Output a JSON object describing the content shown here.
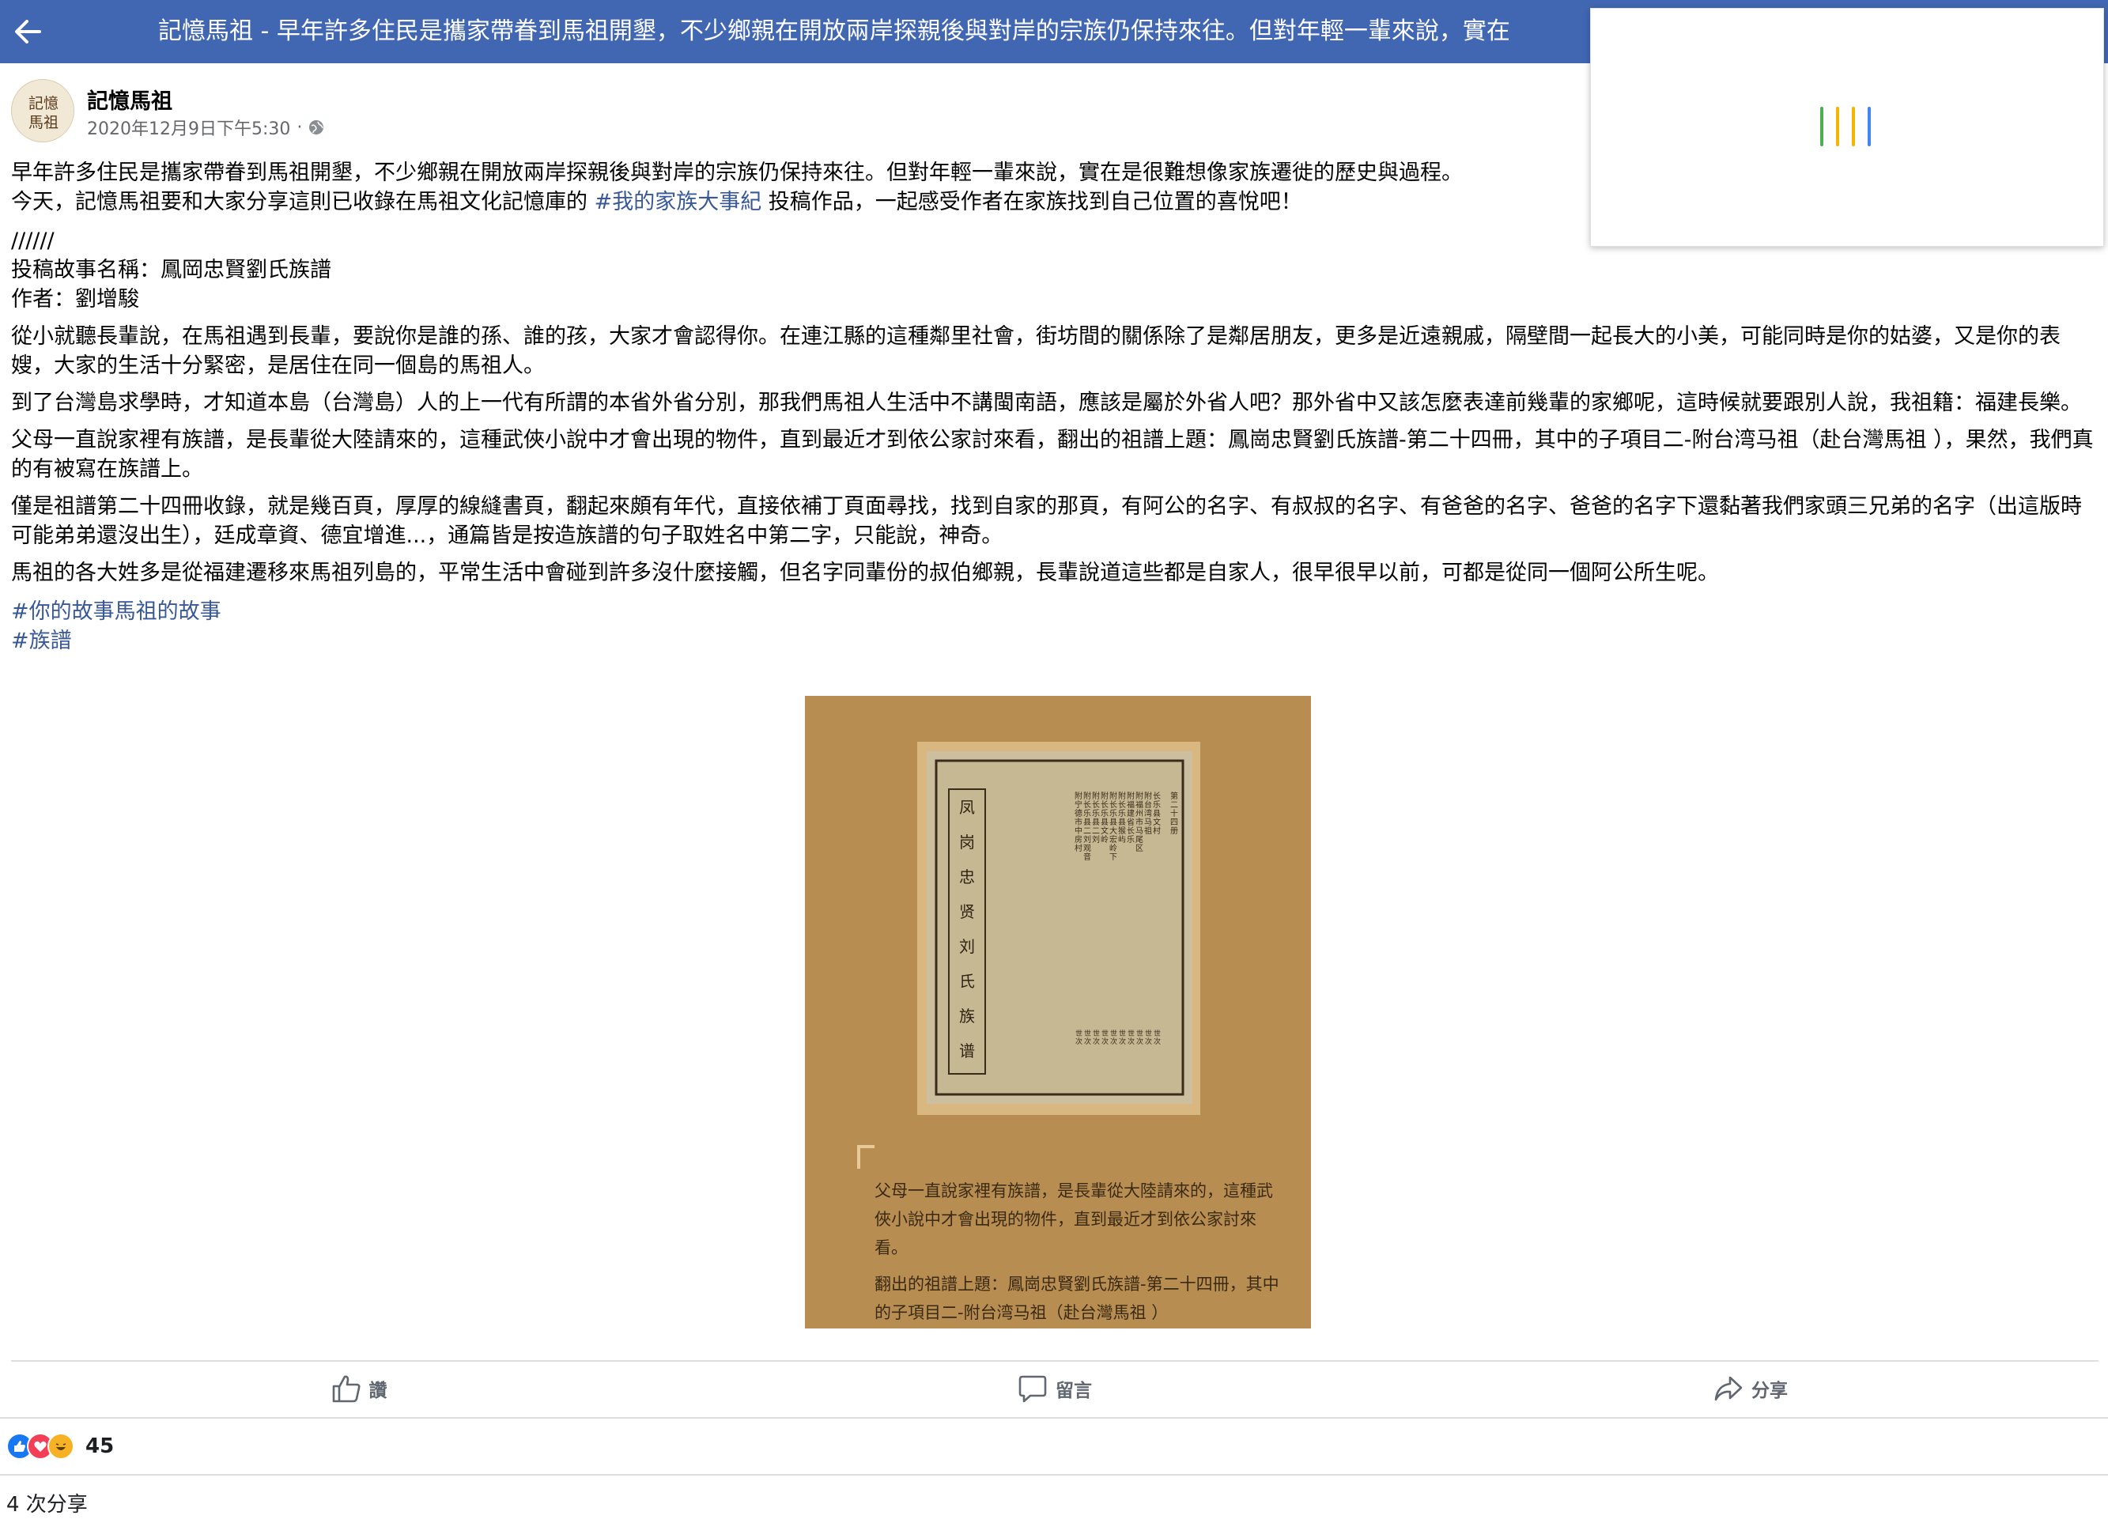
{
  "topbar": {
    "title": "記憶馬祖 - 早年許多住民是攜家帶眷到馬祖開墾，不少鄉親在開放兩岸探親後與對岸的宗族仍保持來往。但對年輕一輩來說，實在"
  },
  "post": {
    "author": "記憶馬祖",
    "avatar_text": "記憶馬祖",
    "timestamp": "2020年12月9日下午5:30",
    "meta_separator": "·",
    "paragraphs": {
      "p1a": "早年許多住民是攜家帶眷到馬祖開墾，不少鄉親在開放兩岸探親後與對岸的宗族仍保持來往。但對年輕一輩來說，實在是很難想像家族遷徙的歷史與過程。",
      "p1b_pre": "今天，記憶馬祖要和大家分享這則已收錄在馬祖文化記憶庫的 ",
      "p1b_tag": "#我的家族大事紀",
      "p1b_post": " 投稿作品，一起感受作者在家族找到自己位置的喜悅吧！",
      "sep": "//////",
      "story_title": "投稿故事名稱：鳳岡忠賢劉氏族譜",
      "story_author": "作者：劉增駿",
      "p2": "從小就聽長輩說，在馬祖遇到長輩，要說你是誰的孫、誰的孩，大家才會認得你。在連江縣的這種鄰里社會，街坊間的關係除了是鄰居朋友，更多是近遠親戚，隔壁間一起長大的小美，可能同時是你的姑婆，又是你的表嫂，大家的生活十分緊密，是居住在同一個島的馬祖人。",
      "p3": "到了台灣島求學時，才知道本島（台灣島）人的上一代有所謂的本省外省分別，那我們馬祖人生活中不講閩南語，應該是屬於外省人吧？那外省中又該怎麼表達前幾輩的家鄉呢，這時候就要跟別人說，我祖籍：福建長樂。",
      "p4": "父母一直說家裡有族譜，是長輩從大陸請來的，這種武俠小說中才會出現的物件，直到最近才到依公家討來看，翻出的祖譜上題：鳳崗忠賢劉氏族譜-第二十四冊，其中的子項目二-附台湾马祖（赴台灣馬祖 ），果然，我們真的有被寫在族譜上。",
      "p5": "僅是祖譜第二十四冊收錄，就是幾百頁，厚厚的線縫書頁，翻起來頗有年代，直接依補丁頁面尋找，找到自家的那頁，有阿公的名字、有叔叔的名字、有爸爸的名字、爸爸的名字下還黏著我們家頭三兄弟的名字（出這版時可能弟弟還沒出生），廷成章資、德宜增進...，通篇皆是按造族譜的句子取姓名中第二字，只能說，神奇。",
      "p6": "馬祖的各大姓多是從福建遷移來馬祖列島的，平常生活中會碰到許多沒什麼接觸，但名字同輩份的叔伯鄉親，長輩說道這些都是自家人，很早很早以前，可都是從同一個阿公所生呢。"
    },
    "hashtags": [
      "#你的故事馬祖的故事",
      "#族譜"
    ]
  },
  "photo": {
    "book_title_chars": [
      "凤",
      "岗",
      "忠",
      "贤",
      "刘",
      "氏",
      "族",
      "谱"
    ],
    "book_header": "第二十四册",
    "book_columns": [
      "长乐县文村",
      "附台湾马祖",
      "附福州市马尾区",
      "附福建省长乐",
      "附长乐县猴屿",
      "附长乐县大宏岭下",
      "附长乐县文岭",
      "附长乐县二刘",
      "附长乐县二刘观音",
      "附宁德市中房村"
    ],
    "book_bottom": [
      "世次",
      "世次",
      "世次",
      "世次",
      "世次",
      "世次",
      "世次",
      "世次",
      "世次",
      "世次"
    ],
    "caption_1": "父母一直說家裡有族譜，是長輩從大陸請來的，這種武俠小說中才會出現的物件，直到最近才到依公家討來看。",
    "caption_2": "翻出的祖譜上題：鳳崗忠賢劉氏族譜-第二十四冊，其中的子項目二-附台湾马祖（赴台灣馬祖 ）"
  },
  "actions": {
    "like": "讚",
    "comment": "留言",
    "share": "分享"
  },
  "reactions": {
    "count": "45"
  },
  "shares": {
    "text": "4 次分享"
  },
  "colors": {
    "topbar": "#4267b2",
    "link": "#385898",
    "loader": [
      "#4caf50",
      "#f4b400",
      "#f4b400",
      "#4285f4"
    ]
  }
}
